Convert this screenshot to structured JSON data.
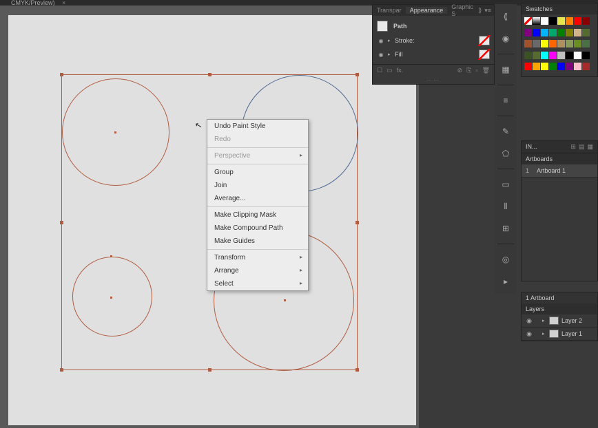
{
  "tab": {
    "title": "CMYK/Preview)"
  },
  "appearance_panel": {
    "tabs": [
      "Transpar",
      "Appearance",
      "Graphic S"
    ],
    "active_tab": 1,
    "object_type": "Path",
    "rows": [
      {
        "label": "Stroke:"
      },
      {
        "label": "Fill"
      }
    ]
  },
  "context_menu": {
    "items": [
      {
        "label": "Undo Paint Style",
        "enabled": true
      },
      {
        "label": "Redo",
        "enabled": false
      },
      {
        "sep": true
      },
      {
        "label": "Perspective",
        "enabled": false,
        "submenu": true
      },
      {
        "sep": true
      },
      {
        "label": "Group",
        "enabled": true
      },
      {
        "label": "Join",
        "enabled": true
      },
      {
        "label": "Average...",
        "enabled": true
      },
      {
        "sep": true
      },
      {
        "label": "Make Clipping Mask",
        "enabled": true
      },
      {
        "label": "Make Compound Path",
        "enabled": true
      },
      {
        "label": "Make Guides",
        "enabled": true
      },
      {
        "sep": true
      },
      {
        "label": "Transform",
        "enabled": true,
        "submenu": true
      },
      {
        "label": "Arrange",
        "enabled": true,
        "submenu": true
      },
      {
        "label": "Select",
        "enabled": true,
        "submenu": true
      }
    ]
  },
  "swatches": {
    "title": "Swatches",
    "colors": [
      "#ffffff",
      "#000000",
      "#e6e64d",
      "#ff8000",
      "#ff0000",
      "#8b0000",
      "#800080",
      "#0000ff",
      "#00b3ff",
      "#00a86b",
      "#008000",
      "#808000",
      "#d2b48c",
      "#556b2f",
      "#a0522d",
      "#696969",
      "#ffff00",
      "#ff6600",
      "#ae8f60",
      "#8a9a5b",
      "#6b8e23",
      "#4b6f44",
      "#3b5323",
      "#556b2f",
      "#00ffff",
      "#ff00ff",
      "#c0c0c0",
      "#000000",
      "#fff",
      "#000",
      "#ff0000",
      "#ffa500",
      "#ffff00",
      "#008000",
      "#0000ff",
      "#800080",
      "#ffc0cb",
      "#a52a2a"
    ]
  },
  "lib": {
    "title": "IN..."
  },
  "artboards": {
    "title": "Artboards",
    "items": [
      {
        "num": "1",
        "name": "Artboard 1"
      }
    ]
  },
  "layers": {
    "header": "1 Artboard",
    "title": "Layers",
    "items": [
      {
        "name": "Layer 2"
      },
      {
        "name": "Layer 1"
      }
    ]
  }
}
